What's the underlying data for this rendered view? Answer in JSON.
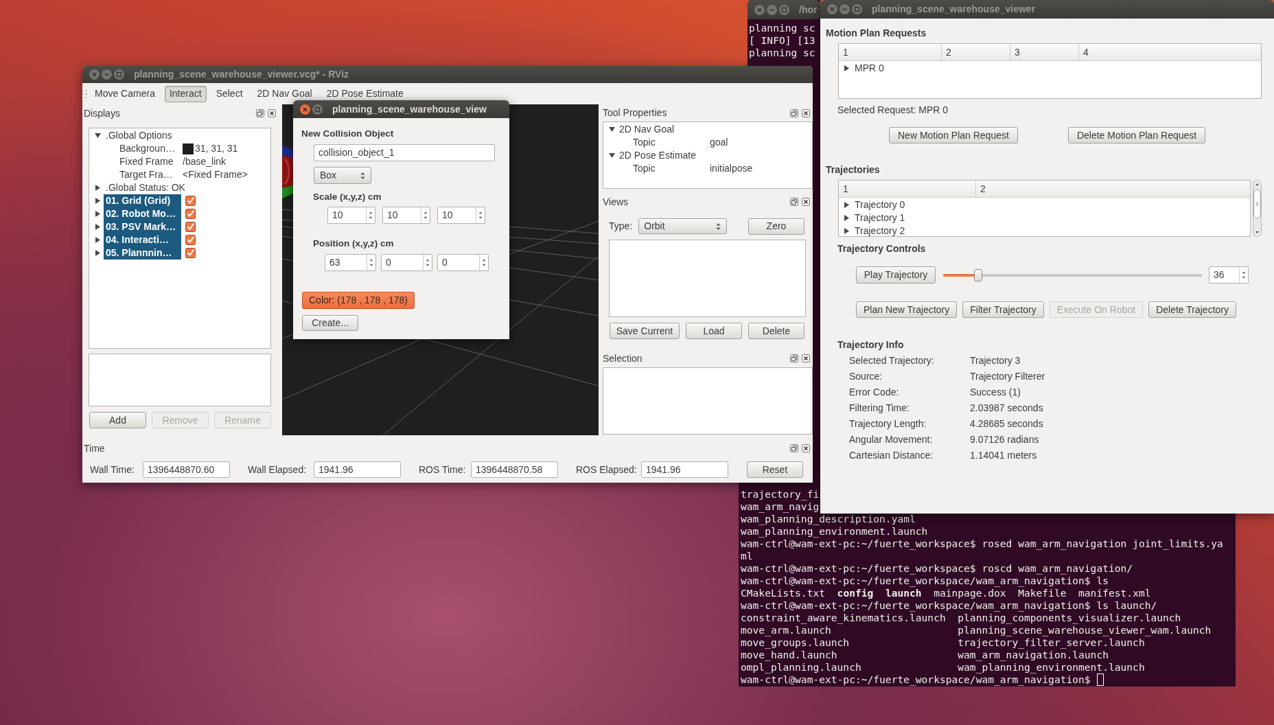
{
  "rviz": {
    "title": "planning_scene_warehouse_viewer.vcg* - RViz",
    "active": false,
    "toolbar": [
      {
        "label": "Move Camera",
        "selected": false
      },
      {
        "label": "Interact",
        "selected": true
      },
      {
        "label": "Select",
        "selected": false
      },
      {
        "label": "2D Nav Goal",
        "selected": false
      },
      {
        "label": "2D Pose Estimate",
        "selected": false
      }
    ],
    "displays": {
      "title": "Displays",
      "items": [
        {
          "kind": "group",
          "label": ".Global Options",
          "expanded": true,
          "selected": false,
          "children": [
            {
              "label": "Backgroun…",
              "value": "31, 31, 31",
              "color": "#1f1f1f"
            },
            {
              "label": "Fixed Frame",
              "value": "/base_link"
            },
            {
              "label": "Target Fra…",
              "value": "<Fixed Frame>"
            }
          ]
        },
        {
          "kind": "group",
          "label": ".Global Status: OK",
          "expanded": false,
          "selected": false
        },
        {
          "kind": "display",
          "label": "01. Grid (Grid)",
          "expanded": false,
          "selected": true,
          "checked": true
        },
        {
          "kind": "display",
          "label": "02. Robot Mo…",
          "expanded": false,
          "selected": true,
          "checked": true
        },
        {
          "kind": "display",
          "label": "03. PSV Mark…",
          "expanded": false,
          "selected": true,
          "checked": true
        },
        {
          "kind": "display",
          "label": "04. Interacti…",
          "expanded": false,
          "selected": true,
          "checked": true
        },
        {
          "kind": "display",
          "label": "05. Plannnin…",
          "expanded": false,
          "selected": true,
          "checked": true
        }
      ],
      "buttons": [
        {
          "label": "Add",
          "disabled": false
        },
        {
          "label": "Remove",
          "disabled": true
        },
        {
          "label": "Rename",
          "disabled": true
        }
      ]
    },
    "tool_properties": {
      "title": "Tool Properties",
      "items": [
        {
          "label": "2D Nav Goal",
          "expanded": true,
          "children": [
            {
              "label": "Topic",
              "value": "goal"
            }
          ]
        },
        {
          "label": "2D Pose Estimate",
          "expanded": true,
          "children": [
            {
              "label": "Topic",
              "value": "initialpose"
            }
          ]
        }
      ]
    },
    "views": {
      "title": "Views",
      "type_label": "Type:",
      "type_value": "Orbit",
      "zero_button": "Zero",
      "buttons": [
        "Save Current",
        "Load",
        "Delete"
      ]
    },
    "selection": {
      "title": "Selection"
    },
    "time": {
      "title": "Time",
      "fields": [
        {
          "label": "Wall Time:",
          "value": "1396448870.60"
        },
        {
          "label": "Wall Elapsed:",
          "value": "1941.96"
        },
        {
          "label": "ROS Time:",
          "value": "1396448870.58"
        },
        {
          "label": "ROS Elapsed:",
          "value": "1941.96"
        }
      ],
      "reset_button": "Reset"
    }
  },
  "collision_dialog": {
    "title": "planning_scene_warehouse_view",
    "active": true,
    "heading": "New Collision Object",
    "name_field": "collision_object_1",
    "shape": "Box",
    "scale": {
      "label": "Scale (x,y,z) cm",
      "values": [
        "10",
        "10",
        "10"
      ]
    },
    "position": {
      "label": "Position (x,y,z) cm",
      "values": [
        "63",
        "0",
        "0"
      ]
    },
    "color_button": "Color: (178 , 178 , 178)",
    "create_button": "Create..."
  },
  "terminal_top": {
    "title": "/hor",
    "active": false,
    "lines": [
      "planning sc",
      "[ INFO] [13",
      "planning sc"
    ]
  },
  "terminal_bottom": {
    "lines": [
      "trajectory_fi",
      "wam_arm_navig",
      "wam_planning_description.yaml",
      "wam_planning_environment.launch",
      "wam-ctrl@wam-ext-pc:~/fuerte_workspace$ rosed wam_arm_navigation joint_limits.ya",
      "ml",
      "wam-ctrl@wam-ext-pc:~/fuerte_workspace$ roscd wam_arm_navigation/",
      "wam-ctrl@wam-ext-pc:~/fuerte_workspace/wam_arm_navigation$ ls",
      "CMakeLists.txt  **config**  **launch**  mainpage.dox  Makefile  manifest.xml",
      "wam-ctrl@wam-ext-pc:~/fuerte_workspace/wam_arm_navigation$ ls launch/",
      "constraint_aware_kinematics.launch  planning_components_visualizer.launch",
      "move_arm.launch                     planning_scene_warehouse_viewer_wam.launch",
      "move_groups.launch                  trajectory_filter_server.launch",
      "move_hand.launch                    wam_arm_navigation.launch",
      "ompl_planning.launch                wam_planning_environment.launch"
    ],
    "prompt": "wam-ctrl@wam-ext-pc:~/fuerte_workspace/wam_arm_navigation$"
  },
  "viewer": {
    "title": "planning_scene_warehouse_viewer",
    "active": false,
    "motion_plan_requests": {
      "title": "Motion Plan Requests",
      "columns": [
        "1",
        "2",
        "3",
        "4"
      ],
      "rows": [
        {
          "label": "MPR 0",
          "expanded": false,
          "selected": false
        }
      ],
      "selected_label": "Selected Request: MPR 0",
      "buttons": [
        {
          "label": "New Motion Plan Request",
          "disabled": false
        },
        {
          "label": "Delete Motion Plan Request",
          "disabled": false
        }
      ]
    },
    "trajectories": {
      "title": "Trajectories",
      "columns": [
        "1",
        "2"
      ],
      "rows": [
        {
          "label": "Trajectory 0",
          "expanded": false,
          "selected": false
        },
        {
          "label": "Trajectory 1",
          "expanded": false,
          "selected": false
        },
        {
          "label": "Trajectory 2",
          "expanded": false,
          "selected": false
        }
      ]
    },
    "trajectory_controls": {
      "title": "Trajectory Controls",
      "play_button": "Play Trajectory",
      "slider": {
        "level": 0.135
      },
      "frame": "36",
      "buttons": [
        {
          "label": "Plan New Trajectory",
          "disabled": false
        },
        {
          "label": "Filter Trajectory",
          "disabled": false
        },
        {
          "label": "Execute On Robot",
          "disabled": true
        },
        {
          "label": "Delete Trajectory",
          "disabled": false
        }
      ]
    },
    "trajectory_info": {
      "title": "Trajectory Info",
      "rows": [
        {
          "label": "Selected Trajectory:",
          "value": "Trajectory 3"
        },
        {
          "label": "Source:",
          "value": "Trajectory Filterer"
        },
        {
          "label": "Error Code:",
          "value": "Success (1)"
        },
        {
          "label": "Filtering Time:",
          "value": "2.03987 seconds"
        },
        {
          "label": "Trajectory Length:",
          "value": "4.28685 seconds"
        },
        {
          "label": "Angular Movement:",
          "value": "9.07126 radians"
        },
        {
          "label": "Cartesian Distance:",
          "value": "1.14041 meters"
        }
      ]
    }
  }
}
